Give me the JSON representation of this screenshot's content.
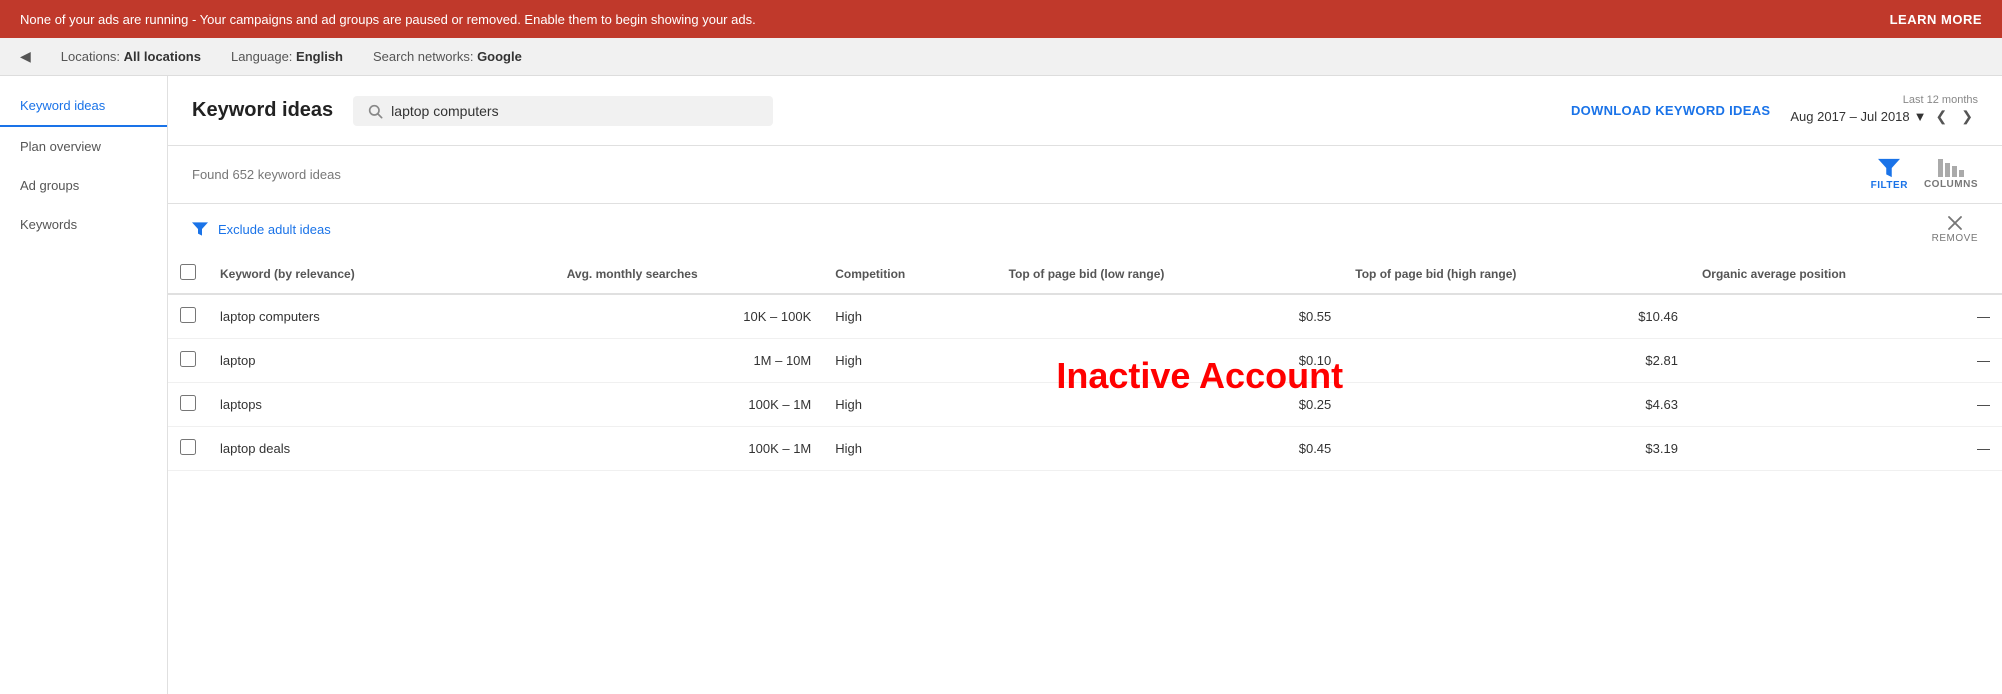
{
  "banner": {
    "message": "None of your ads are running - Your campaigns and ad groups are paused or removed. Enable them to begin showing your ads.",
    "learn_more": "LEARN MORE"
  },
  "subheader": {
    "locations_label": "Locations:",
    "locations_value": "All locations",
    "language_label": "Language:",
    "language_value": "English",
    "networks_label": "Search networks:",
    "networks_value": "Google"
  },
  "sidebar": {
    "items": [
      {
        "id": "keyword-ideas",
        "label": "Keyword ideas",
        "active": true
      },
      {
        "id": "plan-overview",
        "label": "Plan overview",
        "active": false
      },
      {
        "id": "ad-groups",
        "label": "Ad groups",
        "active": false
      },
      {
        "id": "keywords",
        "label": "Keywords",
        "active": false
      }
    ]
  },
  "page_header": {
    "title": "Keyword ideas",
    "search_placeholder": "laptop computers",
    "download_label": "DOWNLOAD KEYWORD IDEAS",
    "date_range_label": "Last 12 months",
    "date_range_value": "Aug 2017 – Jul 2018"
  },
  "results": {
    "count_text": "Found 652 keyword ideas"
  },
  "watermark": {
    "text": "Inactive Account"
  },
  "toolbar": {
    "filter_label": "FILTER",
    "columns_label": "COLUMNS"
  },
  "filter_row": {
    "icon": "funnel",
    "exclude_text": "Exclude adult ideas",
    "remove_label": "REMOVE"
  },
  "table": {
    "columns": [
      {
        "id": "checkbox",
        "label": ""
      },
      {
        "id": "keyword",
        "label": "Keyword (by relevance)"
      },
      {
        "id": "searches",
        "label": "Avg. monthly searches"
      },
      {
        "id": "competition",
        "label": "Competition"
      },
      {
        "id": "bid_low",
        "label": "Top of page bid (low range)"
      },
      {
        "id": "bid_high",
        "label": "Top of page bid (high range)"
      },
      {
        "id": "organic",
        "label": "Organic average position"
      }
    ],
    "rows": [
      {
        "keyword": "laptop computers",
        "searches": "10K – 100K",
        "competition": "High",
        "bid_low": "$0.55",
        "bid_high": "$10.46",
        "organic": "—"
      },
      {
        "keyword": "laptop",
        "searches": "1M – 10M",
        "competition": "High",
        "bid_low": "$0.10",
        "bid_high": "$2.81",
        "organic": "—"
      },
      {
        "keyword": "laptops",
        "searches": "100K – 1M",
        "competition": "High",
        "bid_low": "$0.25",
        "bid_high": "$4.63",
        "organic": "—"
      },
      {
        "keyword": "laptop deals",
        "searches": "100K – 1M",
        "competition": "High",
        "bid_low": "$0.45",
        "bid_high": "$3.19",
        "organic": "—"
      }
    ]
  }
}
